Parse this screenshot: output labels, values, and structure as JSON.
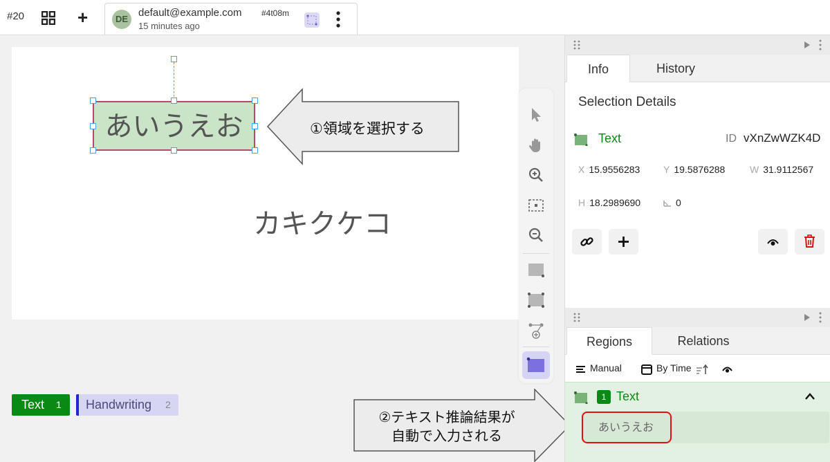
{
  "header": {
    "task_id": "#20",
    "user_initials": "DE",
    "user_email": "default@example.com",
    "user_hash": "#4t08m",
    "user_time": "15 minutes ago"
  },
  "canvas": {
    "selected_region_text": "あいうえお",
    "other_text": "カキクケコ"
  },
  "callouts": {
    "step1": "①領域を選択する",
    "step2_line1": "②テキスト推論結果が",
    "step2_line2": "自動で入力される"
  },
  "tags": [
    {
      "label": "Text",
      "count": "1",
      "color": "#0a8a14"
    },
    {
      "label": "Handwriting",
      "count": "2",
      "color": "#2323d6"
    }
  ],
  "panel": {
    "tabs_top": [
      "Info",
      "History"
    ],
    "selection_title": "Selection Details",
    "region_label": "Text",
    "id_label": "ID",
    "id_value": "vXnZwWZK4D",
    "x_label": "X",
    "x_value": "15.9556283",
    "y_label": "Y",
    "y_value": "19.5876288",
    "w_label": "W",
    "w_value": "31.9112567",
    "h_label": "H",
    "h_value": "18.2989690",
    "angle_value": "0",
    "tabs_bottom": [
      "Regions",
      "Relations"
    ],
    "sort_manual": "Manual",
    "sort_by_time": "By Time",
    "region_item_index": "1",
    "region_item_label": "Text",
    "region_item_value": "あいうえお"
  },
  "colors": {
    "text_label": "#0a8a14",
    "handwriting_label": "#2323d6",
    "selection_fill": "#c9e4c7",
    "highlight_box": "#e01010"
  }
}
